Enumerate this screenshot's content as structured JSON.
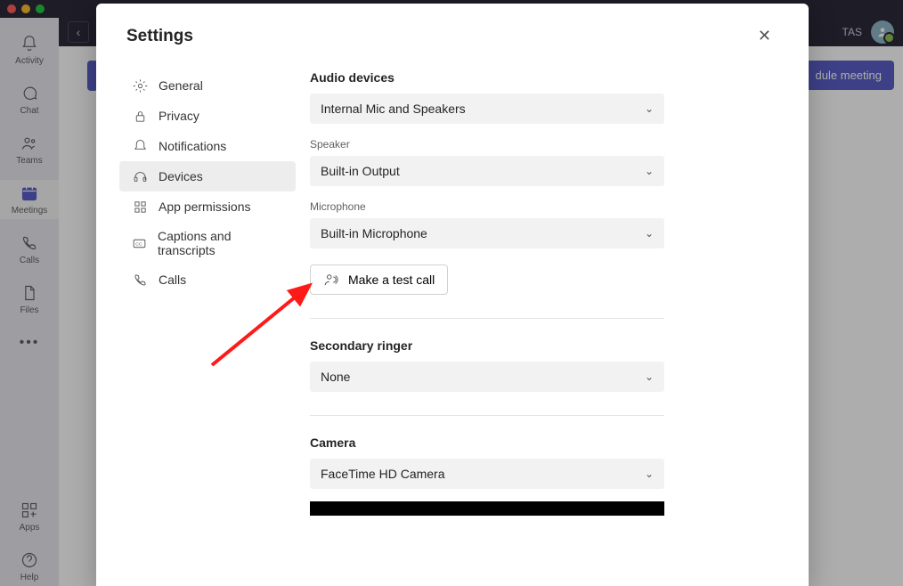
{
  "top": {
    "user_initials": "TAS",
    "back_aria": "Back"
  },
  "rail": {
    "activity": "Activity",
    "chat": "Chat",
    "teams": "Teams",
    "meetings": "Meetings",
    "calls": "Calls",
    "files": "Files",
    "apps": "Apps",
    "help": "Help"
  },
  "main": {
    "schedule_meeting": "dule meeting"
  },
  "dialog": {
    "title": "Settings",
    "nav": {
      "general": "General",
      "privacy": "Privacy",
      "notifications": "Notifications",
      "devices": "Devices",
      "app_permissions": "App permissions",
      "captions": "Captions and transcripts",
      "calls": "Calls"
    },
    "content": {
      "audio_devices_title": "Audio devices",
      "audio_device_value": "Internal Mic and Speakers",
      "speaker_label": "Speaker",
      "speaker_value": "Built-in Output",
      "mic_label": "Microphone",
      "mic_value": "Built-in Microphone",
      "test_call_label": "Make a test call",
      "secondary_ringer_title": "Secondary ringer",
      "secondary_ringer_value": "None",
      "camera_title": "Camera",
      "camera_value": "FaceTime HD Camera"
    }
  }
}
